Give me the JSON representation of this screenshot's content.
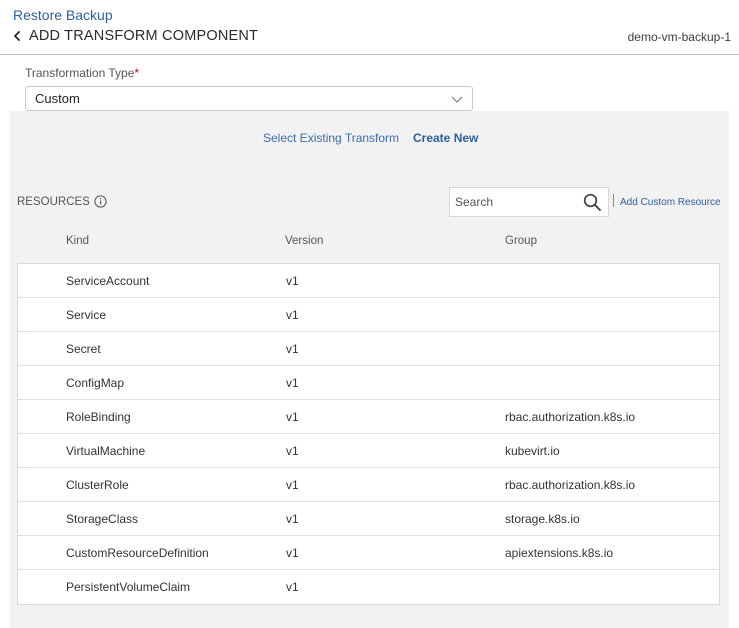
{
  "header": {
    "app_title": "Restore Backup",
    "page_title": "ADD TRANSFORM COMPONENT",
    "backup_name": "demo-vm-backup-1"
  },
  "transformation_type": {
    "label": "Transformation Type",
    "required_mark": "*",
    "value": "Custom"
  },
  "tabs": {
    "select_existing": "Select Existing Transform",
    "create_new": "Create New",
    "active": "create_new"
  },
  "resources": {
    "label": "RESOURCES",
    "search_placeholder": "Search",
    "separator": "|",
    "add_custom_label": "Add Custom Resource",
    "columns": {
      "kind": "Kind",
      "version": "Version",
      "group": "Group"
    },
    "rows": [
      {
        "kind": "ServiceAccount",
        "version": "v1",
        "group": ""
      },
      {
        "kind": "Service",
        "version": "v1",
        "group": ""
      },
      {
        "kind": "Secret",
        "version": "v1",
        "group": ""
      },
      {
        "kind": "ConfigMap",
        "version": "v1",
        "group": ""
      },
      {
        "kind": "RoleBinding",
        "version": "v1",
        "group": "rbac.authorization.k8s.io"
      },
      {
        "kind": "VirtualMachine",
        "version": "v1",
        "group": "kubevirt.io"
      },
      {
        "kind": "ClusterRole",
        "version": "v1",
        "group": "rbac.authorization.k8s.io"
      },
      {
        "kind": "StorageClass",
        "version": "v1",
        "group": "storage.k8s.io"
      },
      {
        "kind": "CustomResourceDefinition",
        "version": "v1",
        "group": "apiextensions.k8s.io"
      },
      {
        "kind": "PersistentVolumeClaim",
        "version": "v1",
        "group": ""
      }
    ]
  },
  "colors": {
    "accent": "#2b5fa3",
    "panel_bg": "#f2f2f2",
    "required": "#d0021b"
  },
  "icons": {
    "back": "chevron-left-icon",
    "dropdown": "chevron-down-icon",
    "info": "info-icon",
    "search": "search-icon"
  }
}
